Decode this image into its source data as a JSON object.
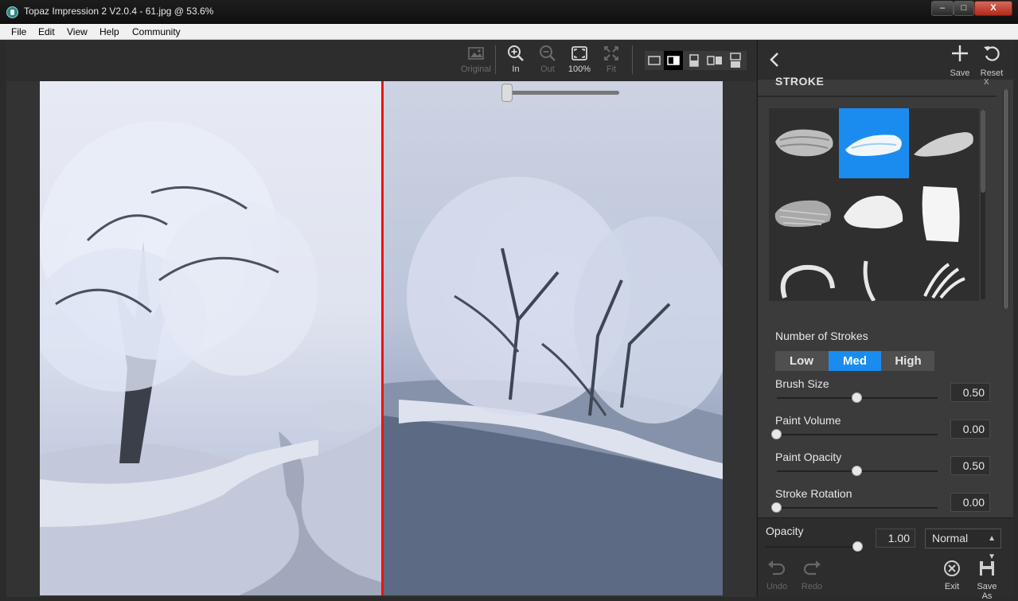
{
  "window": {
    "title": "Topaz Impression 2 V2.0.4 - 61.jpg @ 53.6%",
    "controls": {
      "minimize": "–",
      "maximize": "□",
      "close": "X"
    }
  },
  "menu": [
    "File",
    "Edit",
    "View",
    "Help",
    "Community"
  ],
  "toolbar": {
    "original": "Original",
    "zoom_in": "In",
    "zoom_out": "Out",
    "zoom_100": "100%",
    "fit": "Fit"
  },
  "view_modes": [
    "single-view",
    "split-view",
    "split-vertical-view",
    "side-by-side-view",
    "stacked-view"
  ],
  "panel": {
    "save": "Save",
    "reset": "Reset",
    "section_title": "STROKE",
    "section_close": "x",
    "number_of_strokes": {
      "label": "Number of Strokes",
      "options": [
        "Low",
        "Med",
        "High"
      ],
      "selected": "Med"
    },
    "sliders": [
      {
        "label": "Brush Size",
        "value": "0.50",
        "level": 0.5
      },
      {
        "label": "Paint Volume",
        "value": "0.00",
        "level": 0.0
      },
      {
        "label": "Paint Opacity",
        "value": "0.50",
        "level": 0.5
      },
      {
        "label": "Stroke Rotation",
        "value": "0.00",
        "level": 0.0
      }
    ],
    "footer": {
      "opacity_label": "Opacity",
      "opacity_value": "1.00",
      "opacity_level": 1.0,
      "blend_mode": "Normal",
      "undo": "Undo",
      "redo": "Redo",
      "exit": "Exit",
      "save_as": "Save As"
    }
  },
  "colors": {
    "accent": "#1a8cf0",
    "split_line": "#e8150c",
    "panel_bg": "#3b3b3b",
    "toolbar_bg": "#2d2d2d"
  }
}
